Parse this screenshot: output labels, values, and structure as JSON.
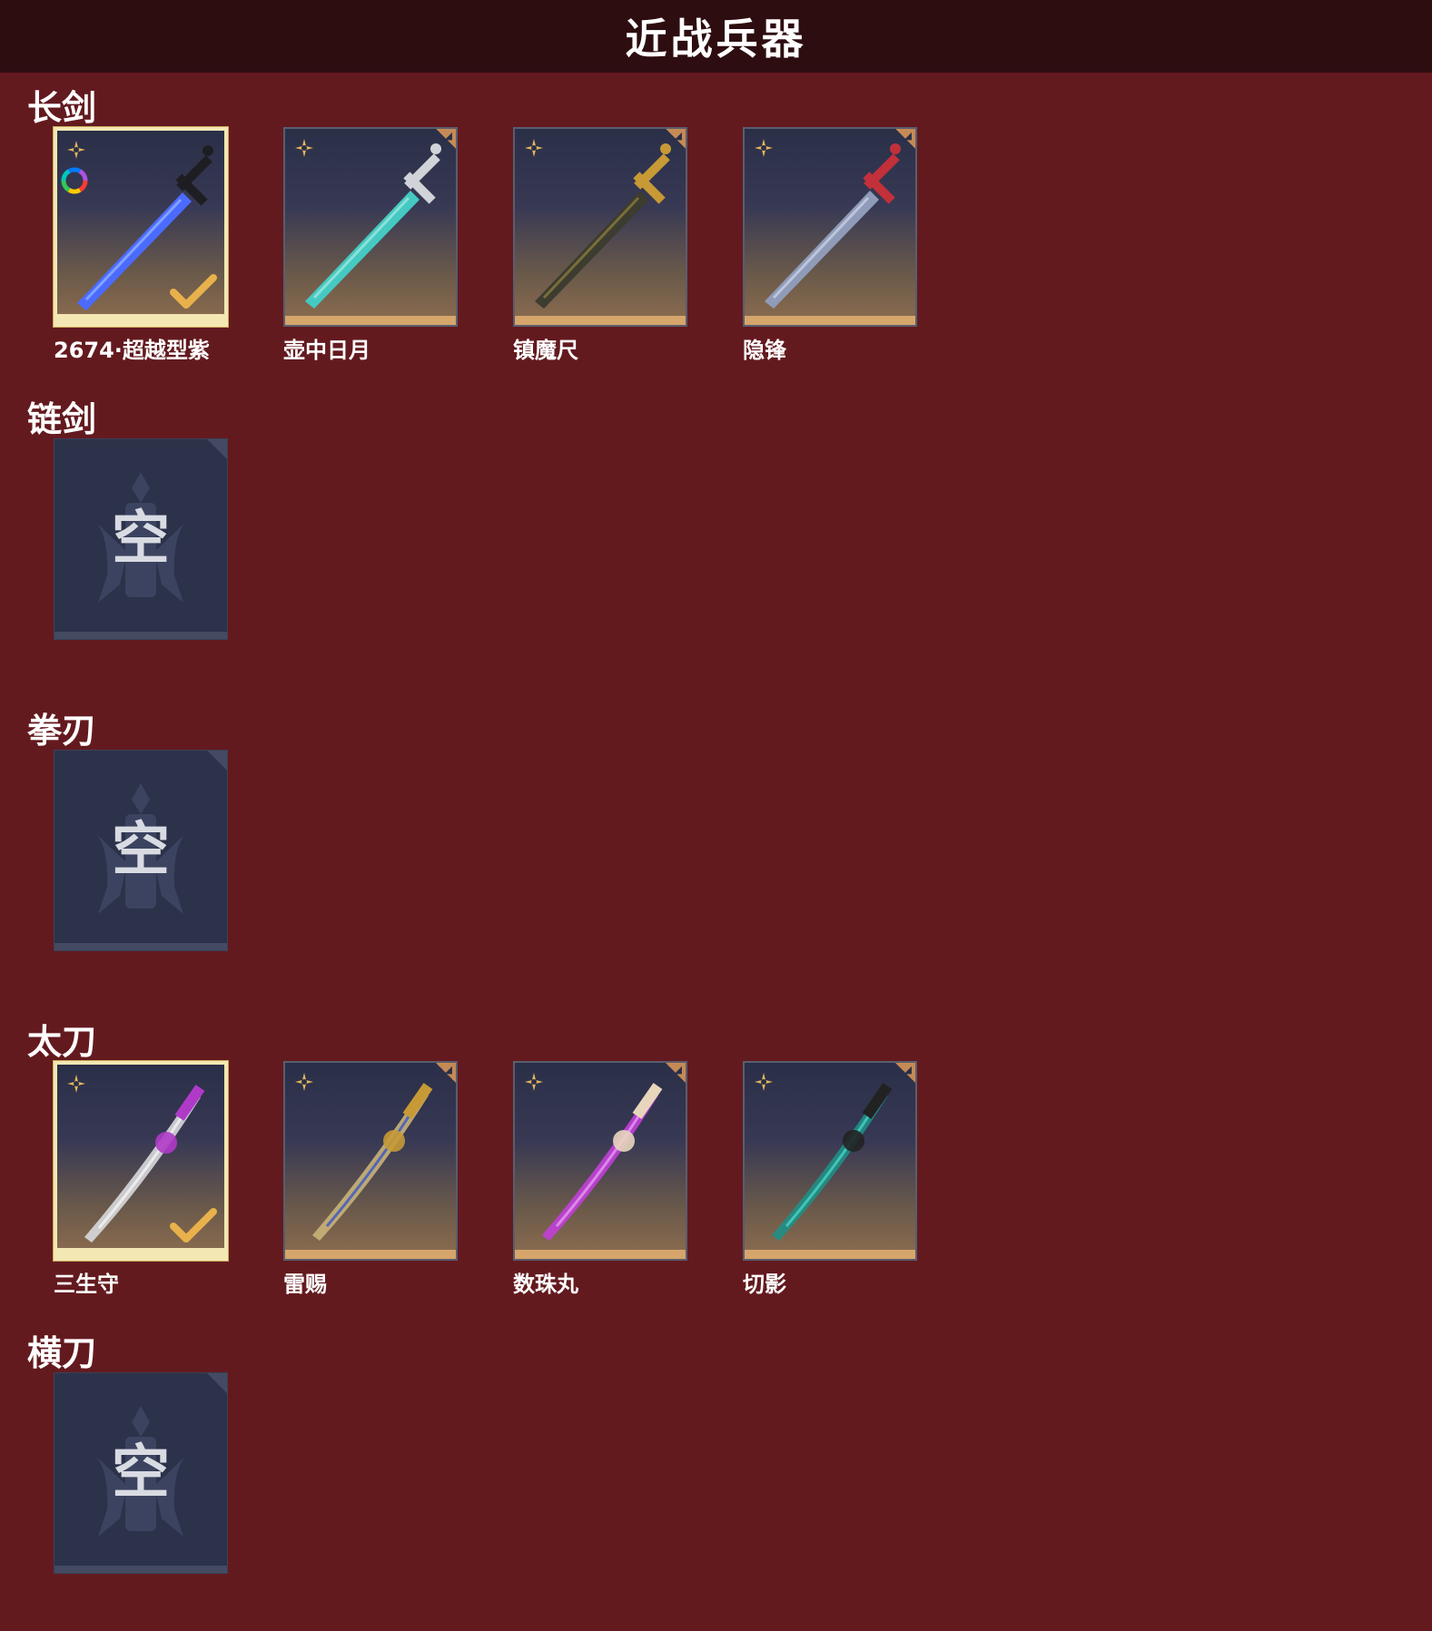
{
  "header": {
    "title": "近战兵器"
  },
  "empty_label": "空",
  "sections": [
    {
      "label": "长剑",
      "items": [
        {
          "name": "2674·超越型紫",
          "selected": true,
          "icon": "blue-energy-sword-icon",
          "blade": "#4b6bff",
          "glow": "#8fb0ff",
          "hilt": "#1e1e22",
          "has_ring": true
        },
        {
          "name": "壶中日月",
          "selected": false,
          "icon": "cyan-crystal-sword-icon",
          "blade": "#45c9c2",
          "glow": "#9de8de",
          "hilt": "#d0d4d8"
        },
        {
          "name": "镇魔尺",
          "selected": false,
          "icon": "dark-gold-sword-icon",
          "blade": "#3c3c30",
          "glow": "#8a7a3c",
          "hilt": "#c79a36"
        },
        {
          "name": "隐锋",
          "selected": false,
          "icon": "red-hilt-sword-icon",
          "blade": "#8f9bb8",
          "glow": "#c8d0e4",
          "hilt": "#c2303a"
        }
      ]
    },
    {
      "label": "链剑",
      "items": []
    },
    {
      "label": "拳刃",
      "items": []
    },
    {
      "label": "太刀",
      "items": [
        {
          "name": "三生守",
          "selected": true,
          "icon": "silver-katana-icon",
          "blade": "#d8d8dc",
          "glow": "#f4f4f6",
          "hilt": "#b03ac8"
        },
        {
          "name": "雷赐",
          "selected": false,
          "icon": "gold-blue-katana-icon",
          "blade": "#c9b279",
          "glow": "#3a56c4",
          "hilt": "#c79a36"
        },
        {
          "name": "数珠丸",
          "selected": false,
          "icon": "purple-katana-icon",
          "blade": "#c23fd8",
          "glow": "#e59bf0",
          "hilt": "#e8d6bc"
        },
        {
          "name": "切影",
          "selected": false,
          "icon": "teal-dark-katana-icon",
          "blade": "#1f8f86",
          "glow": "#4ad3c4",
          "hilt": "#222222"
        }
      ]
    },
    {
      "label": "横刀",
      "items": []
    }
  ],
  "colors": {
    "background": "#631a1f",
    "header": "#2e0d10",
    "star": "#e7b85a",
    "check": "#e9b14b"
  }
}
